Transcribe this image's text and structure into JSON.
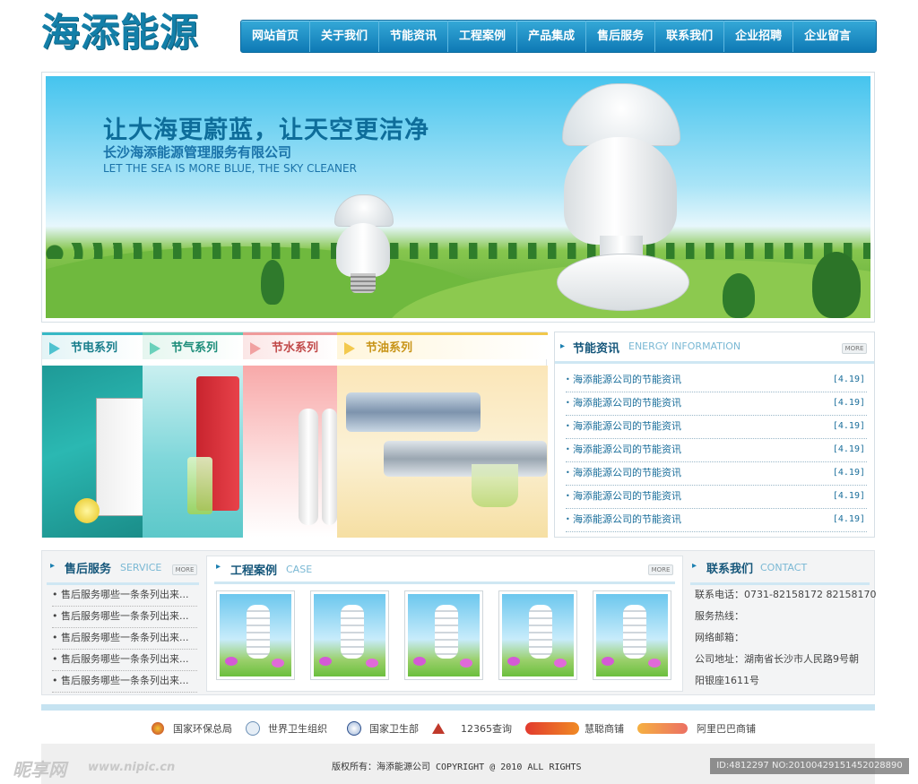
{
  "brand": {
    "logo_text": "海添能源",
    "accent": "#137fa8",
    "nav_color": "#1a8ac6"
  },
  "nav": {
    "items": [
      "网站首页",
      "关于我们",
      "节能资讯",
      "工程案例",
      "产品集成",
      "售后服务",
      "联系我们",
      "企业招聘",
      "企业留言"
    ]
  },
  "banner": {
    "slogan": "让大海更蔚蓝，让天空更洁净",
    "company": "长沙海添能源管理服务有限公司",
    "english": "LET THE SEA IS MORE BLUE, THE SKY CLEANER"
  },
  "series": {
    "tabs": [
      "节电系列",
      "节气系列",
      "节水系列",
      "节油系列"
    ]
  },
  "news": {
    "title": "节能资讯",
    "title_en": "ENERGY INFORMATION",
    "more": "MORE",
    "items": [
      {
        "title": "海添能源公司的节能资讯",
        "date": "[4.19]"
      },
      {
        "title": "海添能源公司的节能资讯",
        "date": "[4.19]"
      },
      {
        "title": "海添能源公司的节能资讯",
        "date": "[4.19]"
      },
      {
        "title": "海添能源公司的节能资讯",
        "date": "[4.19]"
      },
      {
        "title": "海添能源公司的节能资讯",
        "date": "[4.19]"
      },
      {
        "title": "海添能源公司的节能资讯",
        "date": "[4.19]"
      },
      {
        "title": "海添能源公司的节能资讯",
        "date": "[4.19]"
      }
    ]
  },
  "service": {
    "title": "售后服务",
    "title_en": "SERVICE",
    "more": "MORE",
    "items": [
      "售后服务哪些一条条列出来...",
      "售后服务哪些一条条列出来...",
      "售后服务哪些一条条列出来...",
      "售后服务哪些一条条列出来...",
      "售后服务哪些一条条列出来..."
    ]
  },
  "case": {
    "title": "工程案例",
    "title_en": "CASE",
    "more": "MORE"
  },
  "contact": {
    "title": "联系我们",
    "title_en": "CONTACT",
    "phone": "联系电话：0731-82158172  82158170",
    "hotline": "服务热线：",
    "email": "网络邮箱：",
    "address_1": "公司地址：湖南省长沙市人民路9号朝",
    "address_2": "阳银座1611号"
  },
  "footer": {
    "links": [
      "国家环保总局",
      "世界卫生组织",
      "国家卫生部",
      "12365查询",
      "慧聪商铺",
      "阿里巴巴商铺"
    ],
    "copyright": "版权所有：海添能源公司 COPYRIGHT @ 2010 ALL RIGHTS"
  },
  "watermark": {
    "left_text": "昵享网",
    "left_url": "www.nipic.cn",
    "right_text": "ID:4812297 NO:20100429151452028890"
  }
}
